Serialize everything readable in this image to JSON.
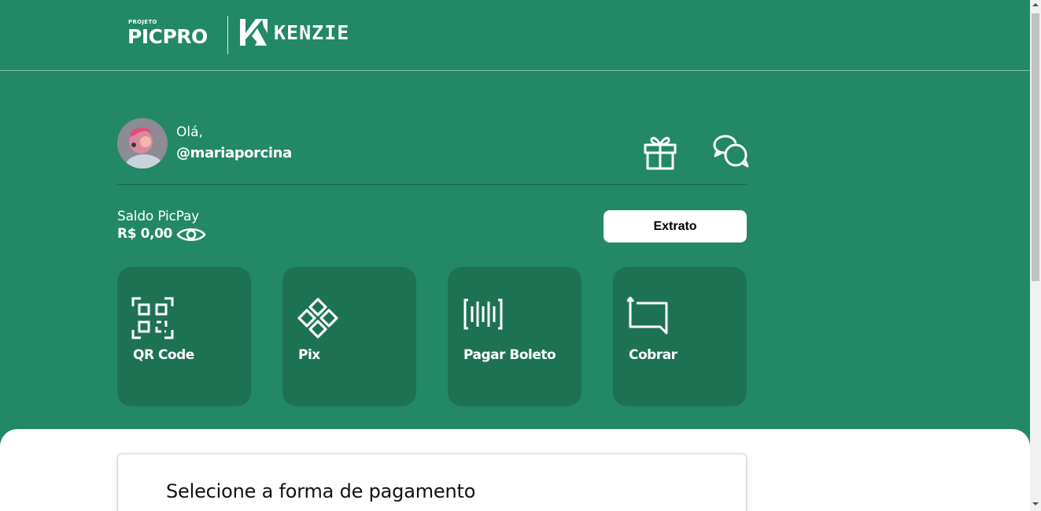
{
  "header": {
    "logo_small": "PROJETO",
    "logo_main": "PICPRO",
    "partner_logo": "KENZIE"
  },
  "user": {
    "greeting": "Olá,",
    "username": "@mariaporcina"
  },
  "icons": {
    "gift": "gift-icon",
    "chat": "chat-icon",
    "eye": "eye-icon",
    "qr": "qr-code-icon",
    "pix": "pix-icon",
    "barcode": "barcode-icon",
    "charge": "charge-icon"
  },
  "balance": {
    "label": "Saldo PicPay",
    "value": "R$ 0,00"
  },
  "buttons": {
    "extrato": "Extrato"
  },
  "actions": [
    {
      "label": "QR Code"
    },
    {
      "label": "Pix"
    },
    {
      "label": "Pagar Boleto"
    },
    {
      "label": "Cobrar"
    }
  ],
  "payment": {
    "title": "Selecione a forma de pagamento"
  },
  "colors": {
    "background": "#228866",
    "card": "#1e7254",
    "panel": "#ffffff"
  }
}
